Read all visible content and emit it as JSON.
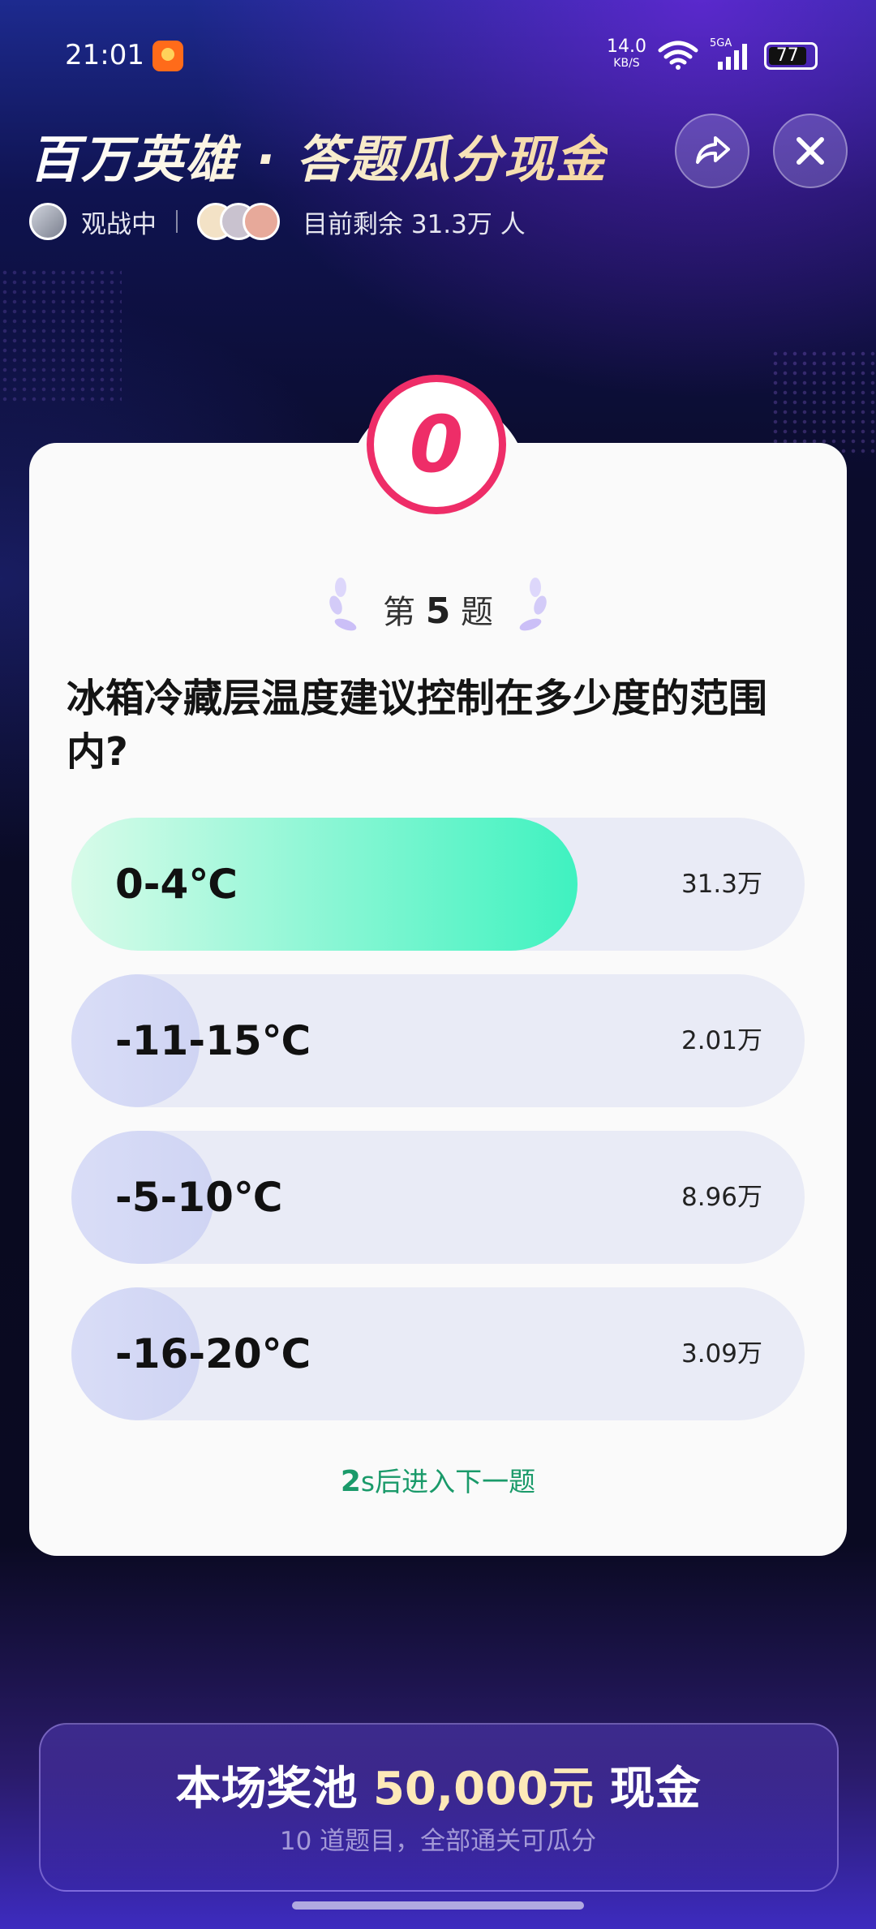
{
  "status_bar": {
    "time": "21:01",
    "net_speed": "14.0",
    "net_unit": "KB/S",
    "signal_label": "5GA",
    "battery": "77"
  },
  "header": {
    "title": "百万英雄 · 答题瓜分现金",
    "watching_label": "观战中",
    "remaining_label": "目前剩余 31.3万 人"
  },
  "quiz": {
    "countdown": "0",
    "question_prefix": "第",
    "question_number": "5",
    "question_suffix": "题",
    "question_text": "冰箱冷藏层温度建议控制在多少度的范围内?",
    "options": [
      {
        "label": "0-4℃",
        "count": "31.3万",
        "share": 0.69,
        "correct": true
      },
      {
        "label": "-11-15℃",
        "count": "2.01万",
        "share": 0.175,
        "correct": false
      },
      {
        "label": "-5-10℃",
        "count": "8.96万",
        "share": 0.195,
        "correct": false
      },
      {
        "label": "-16-20℃",
        "count": "3.09万",
        "share": 0.175,
        "correct": false
      }
    ],
    "next_seconds": "2",
    "next_text": "s后进入下一题"
  },
  "prize_pool": {
    "title_prefix": "本场奖池",
    "amount": "50,000元",
    "title_suffix": "现金",
    "subtitle": "10 道题目，全部通关可瓜分"
  },
  "colors": {
    "accent_pink": "#ee2d68",
    "correct_green": "#3ff2c0",
    "next_text_green": "#1a9a6a",
    "option_bg": "#e9ebf6"
  }
}
